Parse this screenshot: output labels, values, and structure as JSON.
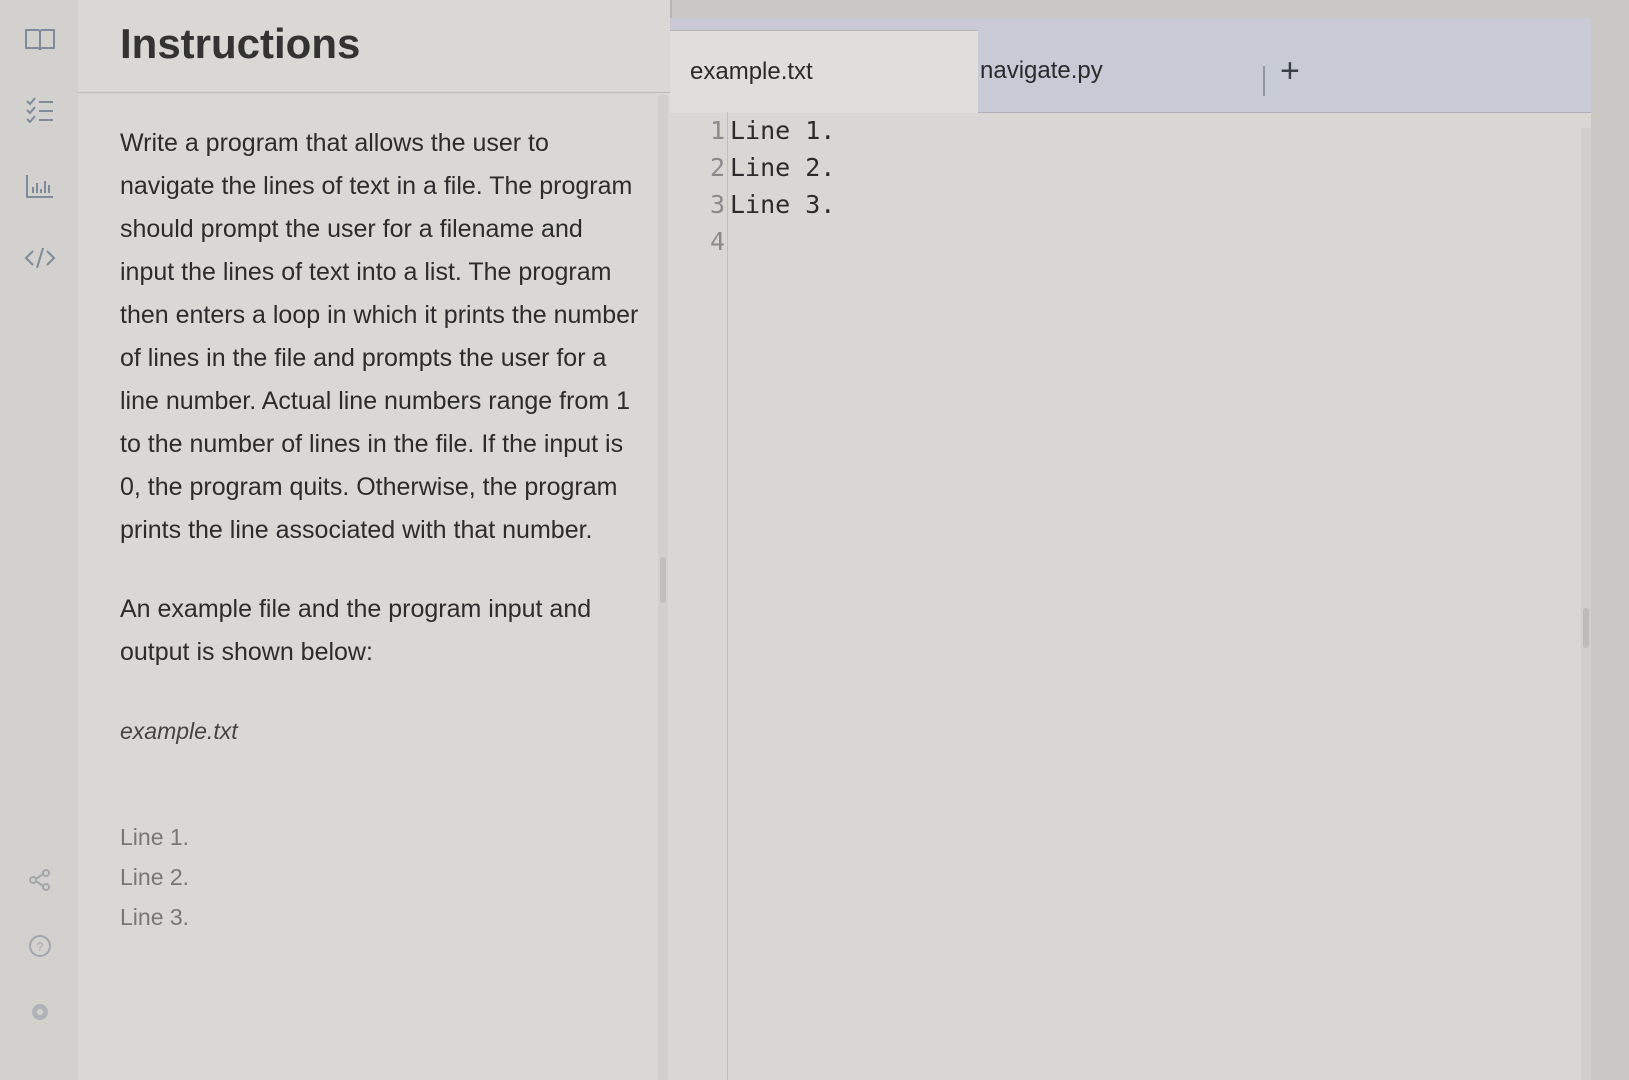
{
  "rail": {
    "icons": [
      "book-icon",
      "checklist-icon",
      "chart-icon",
      "code-icon",
      "share-icon",
      "help-icon",
      "settings-icon"
    ]
  },
  "instructions": {
    "title": "Instructions",
    "paragraph_1": "Write a program that allows the user to navigate the lines of text in a file. The program should prompt the user for a filename and input the lines of text into a list. The program then enters a loop in which it prints the number of lines in the file and prompts the user for a line number. Actual line numbers range from 1 to the number of lines in the file. If the input is 0, the program quits. Otherwise, the program prints the line associated with that number.",
    "paragraph_2": "An example file and the program input and output is shown below:",
    "file_label": "example.txt",
    "sample_lines": [
      "Line 1.",
      "Line 2.",
      "Line 3."
    ]
  },
  "editor": {
    "tabs": [
      {
        "label": "example.txt",
        "active": true
      },
      {
        "label": "navigate.py",
        "active": false
      }
    ],
    "add_label": "+",
    "line_numbers": [
      "1",
      "2",
      "3",
      "4"
    ],
    "lines": [
      "Line 1.",
      "Line 2.",
      "Line 3.",
      ""
    ]
  }
}
